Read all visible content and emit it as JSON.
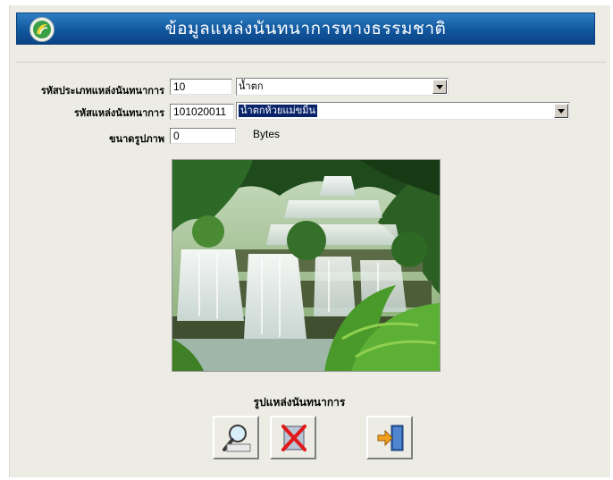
{
  "window": {
    "title": "ข้อมูลแหล่งนันทนาการทางธรรมชาติ"
  },
  "form": {
    "category_code_label": "รหัสประเภทแหล่งนันทนาการ",
    "category_code_value": "10",
    "category_name_selected": "น้ำตก",
    "place_code_label": "รหัสแหล่งนันทนาการ",
    "place_code_value": "101020011",
    "place_name_selected": "น้ำตกห้วยแม่ขมิ้น",
    "image_size_label": "ขนาดรูปภาพ",
    "image_size_value": "0",
    "image_size_unit": "Bytes"
  },
  "image": {
    "caption": "รูปแหล่งนันทนาการ"
  },
  "toolbar": {
    "buttons": [
      {
        "icon": "magnifier-icon"
      },
      {
        "icon": "delete-x-icon"
      },
      {
        "icon": "exit-door-icon"
      }
    ]
  },
  "colors": {
    "banner": "#12579e",
    "panel": "#ecece4",
    "selection": "#0a246a"
  }
}
